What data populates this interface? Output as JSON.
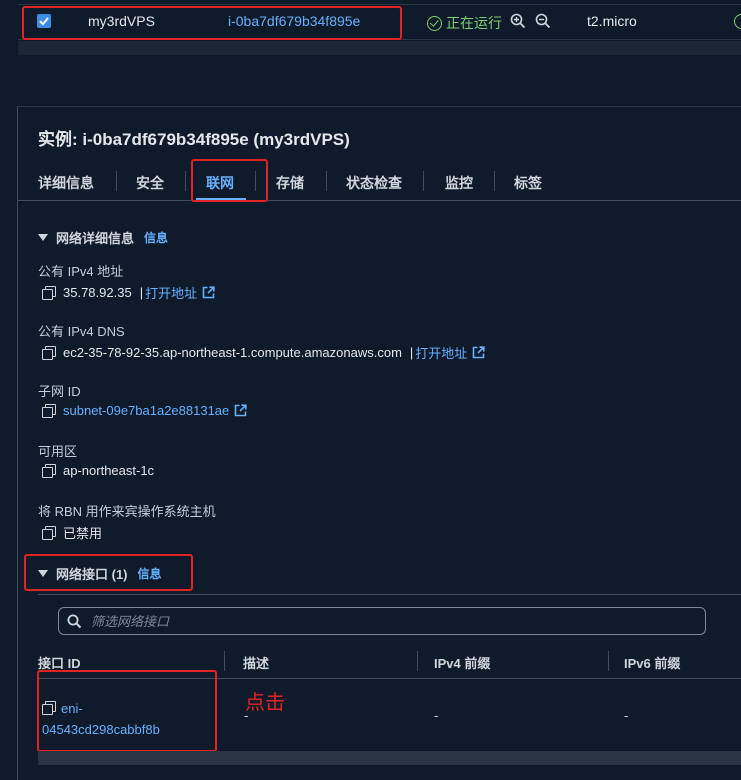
{
  "instance_row": {
    "name": "my3rdVPS",
    "instance_id": "i-0ba7df679b34f895e",
    "status": "正在运行",
    "instance_type": "t2.micro",
    "status_color": "#7bd171"
  },
  "detail": {
    "title": "实例: i-0ba7df679b34f895e (my3rdVPS)",
    "tabs": [
      "详细信息",
      "安全",
      "联网",
      "存储",
      "状态检查",
      "监控",
      "标签"
    ],
    "active_tab": "联网"
  },
  "network_details": {
    "header": "网络详细信息",
    "info_label": "信息",
    "public_ipv4_label": "公有 IPv4 地址",
    "public_ipv4_value": "35.78.92.35",
    "open_address_label": "打开地址",
    "public_dns_label": "公有 IPv4 DNS",
    "public_dns_value": "ec2-35-78-92-35.ap-northeast-1.compute.amazonaws.com",
    "subnet_label": "子网 ID",
    "subnet_value": "subnet-09e7ba1a2e88131ae",
    "az_label": "可用区",
    "az_value": "ap-northeast-1c",
    "rbn_label": "将 RBN 用作来宾操作系统主机",
    "rbn_value": "已禁用"
  },
  "network_interfaces": {
    "header": "网络接口 (1)",
    "info_label": "信息",
    "filter_placeholder": "筛选网络接口",
    "columns": [
      "接口 ID",
      "描述",
      "IPv4 前缀",
      "IPv6 前缀"
    ],
    "rows": [
      {
        "interface_id_line1": "eni-",
        "interface_id_line2": "04543cd298cabbf8b",
        "description": "-",
        "ipv4_prefix": "-",
        "ipv6_prefix": "-"
      }
    ]
  },
  "annotation": {
    "click_note": "点击",
    "color": "#e02424"
  },
  "colors": {
    "accent": "#66b1ff",
    "background": "#0f1b2a"
  }
}
